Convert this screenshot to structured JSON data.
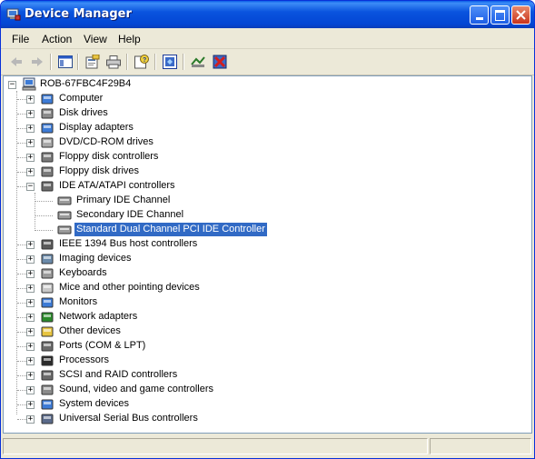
{
  "window": {
    "title": "Device Manager"
  },
  "menu": [
    "File",
    "Action",
    "View",
    "Help"
  ],
  "tree": {
    "root": "ROB-67FBC4F29B4",
    "categories": [
      "Computer",
      "Disk drives",
      "Display adapters",
      "DVD/CD-ROM drives",
      "Floppy disk controllers",
      "Floppy disk drives",
      "IDE ATA/ATAPI controllers",
      "IEEE 1394 Bus host controllers",
      "Imaging devices",
      "Keyboards",
      "Mice and other pointing devices",
      "Monitors",
      "Network adapters",
      "Other devices",
      "Ports (COM & LPT)",
      "Processors",
      "SCSI and RAID controllers",
      "Sound, video and game controllers",
      "System devices",
      "Universal Serial Bus controllers"
    ],
    "ide_children": [
      "Primary IDE Channel",
      "Secondary IDE Channel",
      "Standard Dual Channel PCI IDE Controller"
    ],
    "selected": "Standard Dual Channel PCI IDE Controller"
  },
  "toolbar_icons": [
    "back-icon",
    "forward-icon",
    "show-hide-console-tree-icon",
    "properties-icon",
    "print-icon",
    "help-icon",
    "update-driver-icon",
    "scan-hardware-icon",
    "uninstall-icon"
  ],
  "colors": {
    "titlebar": "#0a54de",
    "selection": "#316ac5"
  }
}
